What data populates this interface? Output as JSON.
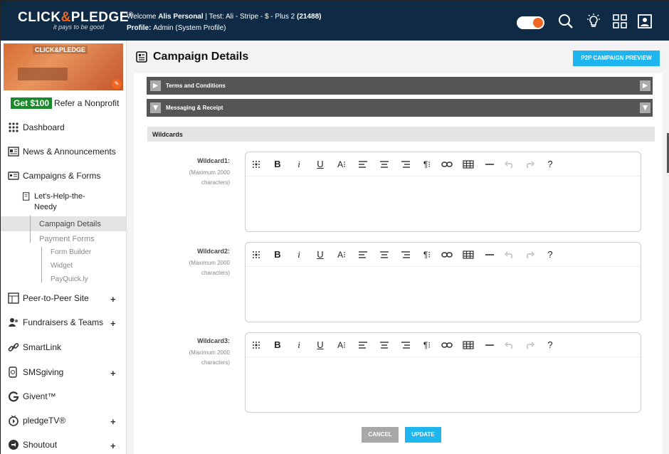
{
  "header": {
    "brand_left": "CLICK",
    "brand_amp": "&",
    "brand_right": "PLEDGE",
    "brand_mark": "®",
    "tagline": "it pays to be good",
    "welcome_prefix": "Welcome ",
    "user_name": "Alis Personal",
    "account_text": " | Test: Ali - Stripe - $ - Plus 2 ",
    "account_id": "(21488)",
    "profile_label": "Profile: ",
    "profile_value": "Admin (System Profile)"
  },
  "sidebar": {
    "banner_sign": "CLICK&PLEDGE",
    "refer_badge": "Get $100",
    "refer_text": "Refer a Nonprofit",
    "items": [
      {
        "label": "Dashboard",
        "icon": "dashboard-grid-icon"
      },
      {
        "label": "News & Announcements",
        "icon": "newspaper-icon"
      },
      {
        "label": "Campaigns & Forms",
        "icon": "campaign-card-icon"
      },
      {
        "label": "Peer-to-Peer Site",
        "icon": "p2p-icon",
        "expandable": true
      },
      {
        "label": "Fundraisers & Teams",
        "icon": "fundraisers-icon",
        "expandable": true
      },
      {
        "label": "SmartLink",
        "icon": "link-icon"
      },
      {
        "label": "SMSgiving",
        "icon": "sms-icon",
        "expandable": true
      },
      {
        "label": "Givent™",
        "icon": "givent-icon"
      },
      {
        "label": "pledgeTV®",
        "icon": "tv-icon",
        "expandable": true
      },
      {
        "label": "Shoutout",
        "icon": "shoutout-icon",
        "expandable": true
      }
    ],
    "plus_symbol": "+",
    "campaign_name_line1": "Let's-Help-the-",
    "campaign_name_line2": "Needy",
    "sub_items": {
      "campaign_details": "Campaign Details",
      "payment_forms": "Payment Forms",
      "form_builder": "Form Builder",
      "widget": "Widget",
      "payquick": "PayQuick.ly"
    }
  },
  "main": {
    "title": "Campaign Details",
    "preview_button": "P2P CAMPAIGN PREVIEW",
    "accordions": [
      {
        "label": "Terms and Conditions",
        "state": "collapsed"
      },
      {
        "label": "Messaging & Receipt",
        "state": "expanded"
      }
    ],
    "section_title": "Wildcards",
    "wildcards": [
      {
        "label": "Wildcard1:",
        "hint_line1": "(Maximum 2000",
        "hint_line2": "characters)",
        "value": ""
      },
      {
        "label": "Wildcard2:",
        "hint_line1": "(Maximum 2000",
        "hint_line2": "characters)",
        "value": ""
      },
      {
        "label": "Wildcard3:",
        "hint_line1": "(Maximum 2000",
        "hint_line2": "characters)",
        "value": ""
      }
    ],
    "toolbar": {
      "bold": "B",
      "italic": "i",
      "underline": "U",
      "font_size": "A⁝",
      "paragraph": "¶⁝",
      "help": "?"
    },
    "cancel_button": "CANCEL",
    "update_button": "UPDATE"
  },
  "colors": {
    "header_bg": "#0e2a45",
    "accent_orange": "#f26722",
    "accent_blue": "#1fb5ef",
    "accordion_bg": "#555555"
  }
}
